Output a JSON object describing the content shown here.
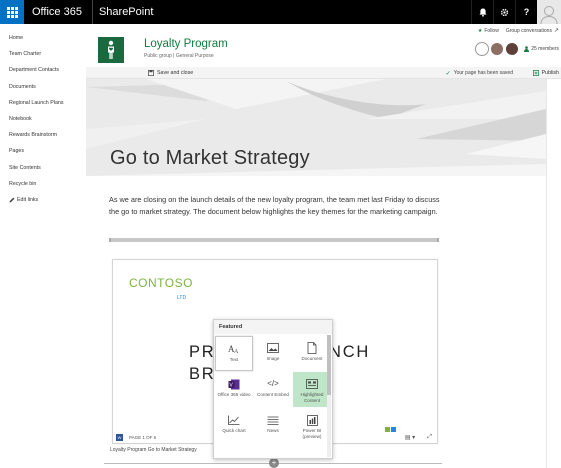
{
  "suite": {
    "brand": "Office 365",
    "app": "SharePoint",
    "help_glyph": "?"
  },
  "nav": {
    "items": [
      "Home",
      "Team Charter",
      "Department Contacts",
      "Documents",
      "Regional Launch Plans",
      "Notebook",
      "Rewards Brainstorm",
      "Pages",
      "Site Contents",
      "Recycle bin"
    ],
    "edit_links": "Edit links"
  },
  "site": {
    "title": "Loyalty Program",
    "subtitle": "Public group  |  General Purpose",
    "follow": "Follow",
    "group_conversations": "Group conversations",
    "members": "25 members"
  },
  "command_bar": {
    "save_close": "Save and close",
    "status": "Your page has been saved",
    "publish": "Publish"
  },
  "page": {
    "title": "Go to Market Strategy",
    "body": "As we are closing on the launch details of the new loyalty program, the team met last Friday to discuss the go to market strategy. The document below highlights the key themes for the marketing campaign."
  },
  "document": {
    "logo": "CONTOSO",
    "logo_sub": "LTD",
    "line1_left": "PR",
    "line1_right": "NCH",
    "line2_left": "BR",
    "page_indicator": "PAGE 1 OF 6",
    "caption": "Loyalty Program Go to Market Strategy"
  },
  "toolbox": {
    "header": "Featured",
    "items": [
      {
        "label": "Text",
        "icon": "text-icon"
      },
      {
        "label": "Image",
        "icon": "image-icon"
      },
      {
        "label": "Document",
        "icon": "document-icon"
      },
      {
        "label": "Office 365 video",
        "icon": "video-icon"
      },
      {
        "label": "Content Embed",
        "icon": "embed-icon"
      },
      {
        "label": "Highlighted Content",
        "icon": "highlighted-content-icon"
      },
      {
        "label": "Quick chart",
        "icon": "chart-icon"
      },
      {
        "label": "News",
        "icon": "news-icon"
      },
      {
        "label": "Power BI (preview)",
        "icon": "powerbi-icon"
      }
    ]
  },
  "colors": {
    "suite_bar": "#000000",
    "waffle": "#0072c6",
    "site_accent": "#107c41",
    "highlight_tile": "#bfe6c8"
  }
}
